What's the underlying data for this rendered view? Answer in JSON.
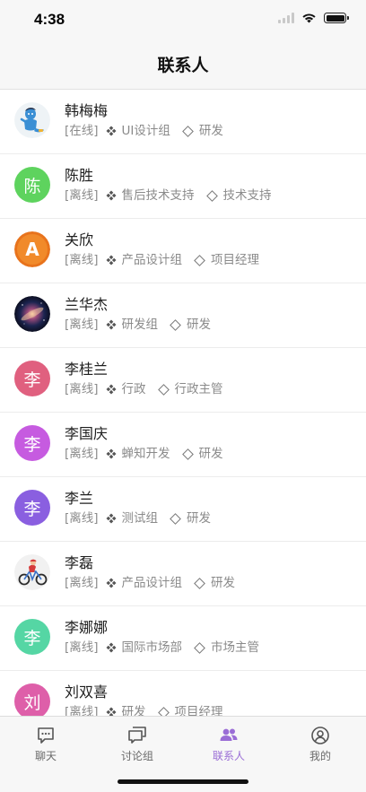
{
  "status_bar": {
    "time": "4:38"
  },
  "nav": {
    "title": "联系人"
  },
  "contacts": [
    {
      "name": "韩梅梅",
      "status": "[在线]",
      "department": "UI设计组",
      "position": "研发",
      "avatar_type": "icon",
      "avatar_icon": "genie-avatar-icon"
    },
    {
      "name": "陈胜",
      "status": "[离线]",
      "department": "售后技术支持",
      "position": "技术支持",
      "avatar_type": "char",
      "avatar_char": "陈",
      "avatar_color": "#5ed35e"
    },
    {
      "name": "关欣",
      "status": "[离线]",
      "department": "产品设计组",
      "position": "项目经理",
      "avatar_type": "icon",
      "avatar_icon": "letter-a-avatar-icon"
    },
    {
      "name": "兰华杰",
      "status": "[离线]",
      "department": "研发组",
      "position": "研发",
      "avatar_type": "icon",
      "avatar_icon": "galaxy-avatar-icon"
    },
    {
      "name": "李桂兰",
      "status": "[离线]",
      "department": "行政",
      "position": "行政主管",
      "avatar_type": "char",
      "avatar_char": "李",
      "avatar_color": "#e0607f"
    },
    {
      "name": "李国庆",
      "status": "[离线]",
      "department": "蝉知开发",
      "position": "研发",
      "avatar_type": "char",
      "avatar_char": "李",
      "avatar_color": "#c65be0"
    },
    {
      "name": "李兰",
      "status": "[离线]",
      "department": "测试组",
      "position": "研发",
      "avatar_type": "char",
      "avatar_char": "李",
      "avatar_color": "#8a5fe0"
    },
    {
      "name": "李磊",
      "status": "[离线]",
      "department": "产品设计组",
      "position": "研发",
      "avatar_type": "icon",
      "avatar_icon": "cyclist-avatar-icon"
    },
    {
      "name": "李娜娜",
      "status": "[离线]",
      "department": "国际市场部",
      "position": "市场主管",
      "avatar_type": "char",
      "avatar_char": "李",
      "avatar_color": "#55d6a4"
    },
    {
      "name": "刘双喜",
      "status": "[离线]",
      "department": "研发",
      "position": "项目经理",
      "avatar_type": "char",
      "avatar_char": "刘",
      "avatar_color": "#de5fa9"
    }
  ],
  "tabs": [
    {
      "label": "聊天",
      "icon": "chat-bubble-icon",
      "active": false
    },
    {
      "label": "讨论组",
      "icon": "discussion-icon",
      "active": false
    },
    {
      "label": "联系人",
      "icon": "contacts-icon",
      "active": true
    },
    {
      "label": "我的",
      "icon": "profile-icon",
      "active": false
    }
  ],
  "colors": {
    "accent": "#9a6dd6",
    "secondary_text": "#8a8a8a"
  }
}
